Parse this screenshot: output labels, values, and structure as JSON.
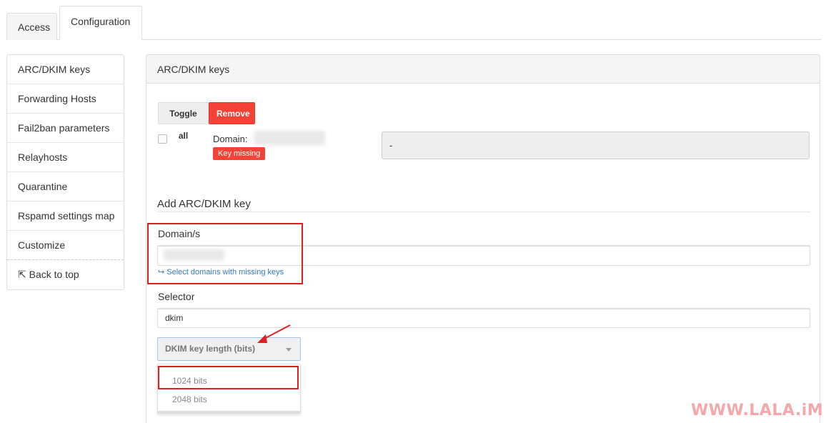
{
  "tabs": {
    "access": "Access",
    "configuration": "Configuration"
  },
  "sidebar": {
    "items": [
      {
        "label": "ARC/DKIM keys"
      },
      {
        "label": "Forwarding Hosts"
      },
      {
        "label": "Fail2ban parameters"
      },
      {
        "label": "Relayhosts"
      },
      {
        "label": "Quarantine"
      },
      {
        "label": "Rspamd settings map"
      },
      {
        "label": "Customize"
      }
    ],
    "back_to_top": "⇱ Back to top"
  },
  "panel": {
    "title": "ARC/DKIM keys",
    "toggle_all": "Toggle all",
    "remove": "Remove",
    "domain_label": "Domain:",
    "key_missing": "Key missing",
    "key_value": "-",
    "add_title": "Add ARC/DKIM key",
    "domains_label": "Domain/s",
    "select_missing_link": "↪ Select domains with missing keys",
    "selector_label": "Selector",
    "selector_value": "dkim",
    "key_length_placeholder": "DKIM key length (bits)",
    "key_length_options": [
      "1024  bits",
      "2048  bits"
    ]
  },
  "watermark": "WWW.LALA.iM",
  "colors": {
    "accent_red": "#f44336",
    "highlight": "#e02020",
    "link": "#337ab7"
  },
  "icons": {
    "dropdown": "caret-down-icon",
    "annotation": "red-arrow-icon"
  }
}
